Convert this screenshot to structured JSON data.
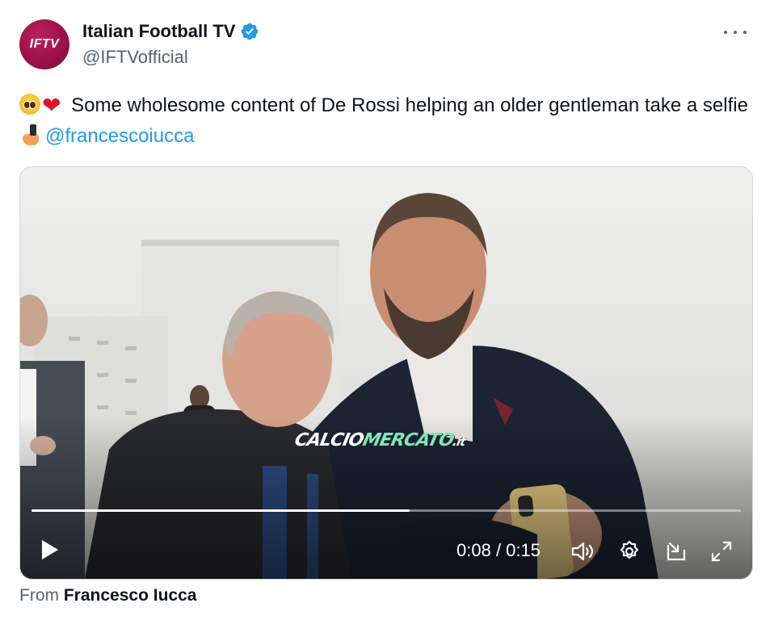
{
  "author": {
    "avatar_text": "IFTV",
    "avatar_color": "#9a1246",
    "display_name": "Italian Football TV",
    "verified_icon": "verified-badge-icon",
    "handle": "@IFTVofficial"
  },
  "more_icon": "more-options-icon",
  "tweet": {
    "text_part1": "Some wholesome content of De Rossi helping an older gentleman take a selfie",
    "mention": "@francescoiucca",
    "emojis": [
      "pleading-face",
      "red-heart",
      "selfie"
    ]
  },
  "video": {
    "watermark_part1": "CALCIO",
    "watermark_part2": "MERCATO",
    "watermark_part3": ".it",
    "current_time": "0:08",
    "separator": " / ",
    "duration": "0:15",
    "progress": 0.5333,
    "controls": [
      "play-icon",
      "volume-icon",
      "settings-icon",
      "dock-icon",
      "fullscreen-icon"
    ]
  },
  "source": {
    "prefix": "From",
    "name": "Francesco Iucca"
  },
  "colors": {
    "link": "#1d9bf0",
    "text": "#0f1419",
    "secondary": "#536471",
    "verified": "#1d9bf0"
  }
}
